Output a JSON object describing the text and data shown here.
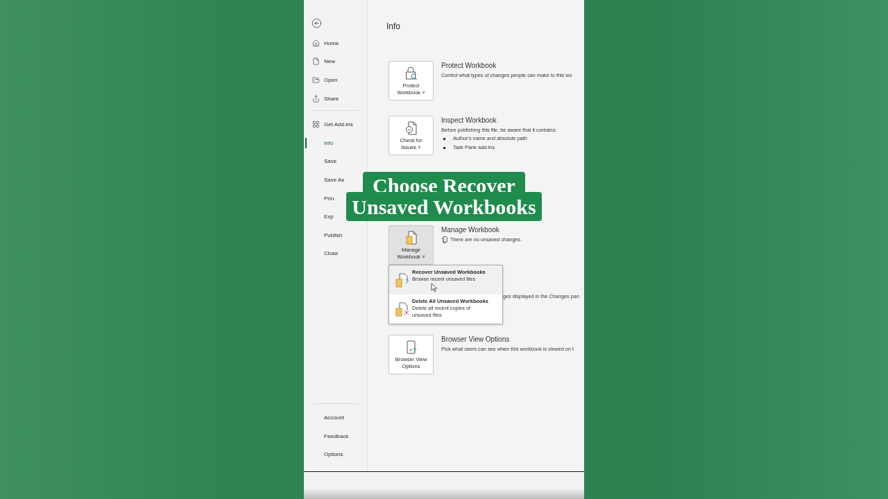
{
  "sidebar": {
    "top_items": [
      {
        "label": "Home",
        "kind": "home",
        "selected": false
      },
      {
        "label": "New",
        "kind": "new",
        "selected": false
      },
      {
        "label": "Open",
        "kind": "open",
        "selected": false
      },
      {
        "label": "Share",
        "kind": "share",
        "selected": false
      }
    ],
    "items": [
      {
        "label": "Get Add-ins",
        "kind": "addins",
        "selected": false
      },
      {
        "label": "Info",
        "selected": true
      },
      {
        "label": "Save",
        "selected": false
      },
      {
        "label": "Save As",
        "selected": false
      },
      {
        "label": "Prin",
        "selected": false
      },
      {
        "label": "Exp",
        "selected": false
      },
      {
        "label": "Publish",
        "selected": false
      },
      {
        "label": "Close",
        "selected": false
      }
    ],
    "bottom_items": [
      {
        "label": "Account",
        "selected": false
      },
      {
        "label": "Feedback",
        "selected": false
      },
      {
        "label": "Options",
        "selected": false
      }
    ]
  },
  "page_title": "Info",
  "sections": [
    {
      "kind": "protect",
      "button": [
        "Protect",
        "Workbook ˅"
      ],
      "title": "Protect Workbook",
      "description": "Control what types of changes people can make to this wo"
    },
    {
      "kind": "inspect",
      "button": [
        "Check for",
        "Issues ˅"
      ],
      "title": "Inspect Workbook",
      "description": "Before publishing this file, be aware that it contains:",
      "bullets": [
        "Author's name and absolute path",
        "Task Pane add-ins"
      ]
    },
    {
      "kind": "hidden"
    },
    {
      "kind": "manage",
      "button": [
        "Manage",
        "Workbook ˅"
      ],
      "title": "Manage Workbook",
      "description": "There are no unsaved changes.",
      "pressed": true
    },
    {
      "kind": "covered",
      "description": "ges displayed in the Changes pan"
    },
    {
      "kind": "browser",
      "button": [
        "Browser View",
        "Options"
      ],
      "title": "Browser View Options",
      "description": "Pick what users can see when this workbook is viewed on t"
    }
  ],
  "dropdown": {
    "items": [
      {
        "kind": "recover",
        "title": "Recover Unsaved Workbooks",
        "description": "Browse recent unsaved files",
        "highlighted": true
      },
      {
        "kind": "delete",
        "title": "Delete All Unsaved Workbooks",
        "description": "Delete all recent copies of unsaved files",
        "highlighted": false
      }
    ]
  },
  "caption": {
    "lines": [
      "Choose Recover",
      "Unsaved Workbooks"
    ]
  }
}
